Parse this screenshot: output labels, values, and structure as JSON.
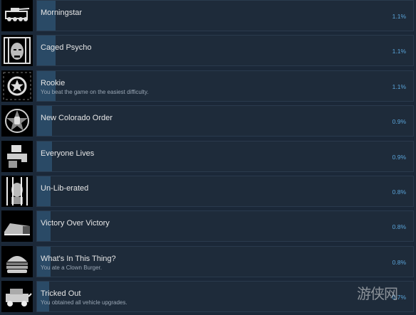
{
  "achievements": [
    {
      "name": "Morningstar",
      "description": "",
      "percent": "1.1%",
      "icon": "tank-icon",
      "progress": 0.011
    },
    {
      "name": "Caged Psycho",
      "description": "",
      "percent": "1.1%",
      "icon": "caged-face-icon",
      "progress": 0.011
    },
    {
      "name": "Rookie",
      "description": "You beat the game on the easiest difficulty.",
      "percent": "1.1%",
      "icon": "badge-star-icon",
      "progress": 0.011
    },
    {
      "name": "New Colorado Order",
      "description": "",
      "percent": "0.9%",
      "icon": "fist-star-icon",
      "progress": 0.009
    },
    {
      "name": "Everyone Lives",
      "description": "",
      "percent": "0.9%",
      "icon": "hand-gun-icon",
      "progress": 0.009
    },
    {
      "name": "Un-Lib-erated",
      "description": "",
      "percent": "0.8%",
      "icon": "prisoner-bars-icon",
      "progress": 0.008
    },
    {
      "name": "Victory Over Victory",
      "description": "",
      "percent": "0.8%",
      "icon": "bunker-icon",
      "progress": 0.008
    },
    {
      "name": "What's In This Thing?",
      "description": "You ate a Clown Burger.",
      "percent": "0.8%",
      "icon": "burger-icon",
      "progress": 0.008
    },
    {
      "name": "Tricked Out",
      "description": "You obtained all vehicle upgrades.",
      "percent": "0.7%",
      "icon": "vehicle-icon",
      "progress": 0.007
    }
  ],
  "watermark": "游侠网"
}
